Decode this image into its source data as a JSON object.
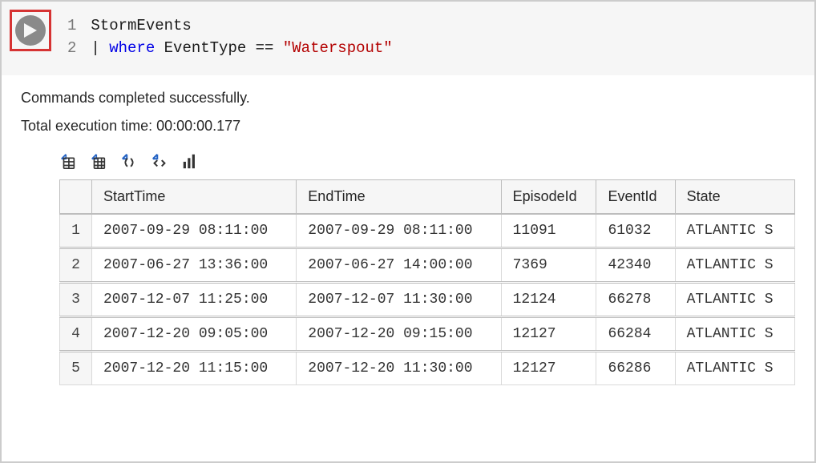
{
  "editor": {
    "lines": [
      {
        "n": "1",
        "plain": "StormEvents"
      },
      {
        "n": "2",
        "pipe": "| ",
        "keyword": "where",
        "rest": " EventType == ",
        "string": "\"Waterspout\""
      }
    ]
  },
  "status": {
    "message": "Commands completed successfully.",
    "exec_time_label": "Total execution time: 00:00:00.177"
  },
  "toolbar": {
    "icons": [
      "export-csv-icon",
      "export-grid-icon",
      "export-json-icon",
      "export-code-icon",
      "chart-icon"
    ]
  },
  "table": {
    "columns": [
      "StartTime",
      "EndTime",
      "EpisodeId",
      "EventId",
      "State"
    ],
    "rows": [
      {
        "n": "1",
        "cells": [
          "2007-09-29 08:11:00",
          "2007-09-29 08:11:00",
          "11091",
          "61032",
          "ATLANTIC S"
        ]
      },
      {
        "n": "2",
        "cells": [
          "2007-06-27 13:36:00",
          "2007-06-27 14:00:00",
          "7369",
          "42340",
          "ATLANTIC S"
        ]
      },
      {
        "n": "3",
        "cells": [
          "2007-12-07 11:25:00",
          "2007-12-07 11:30:00",
          "12124",
          "66278",
          "ATLANTIC S"
        ]
      },
      {
        "n": "4",
        "cells": [
          "2007-12-20 09:05:00",
          "2007-12-20 09:15:00",
          "12127",
          "66284",
          "ATLANTIC S"
        ]
      },
      {
        "n": "5",
        "cells": [
          "2007-12-20 11:15:00",
          "2007-12-20 11:30:00",
          "12127",
          "66286",
          "ATLANTIC S"
        ]
      }
    ]
  }
}
